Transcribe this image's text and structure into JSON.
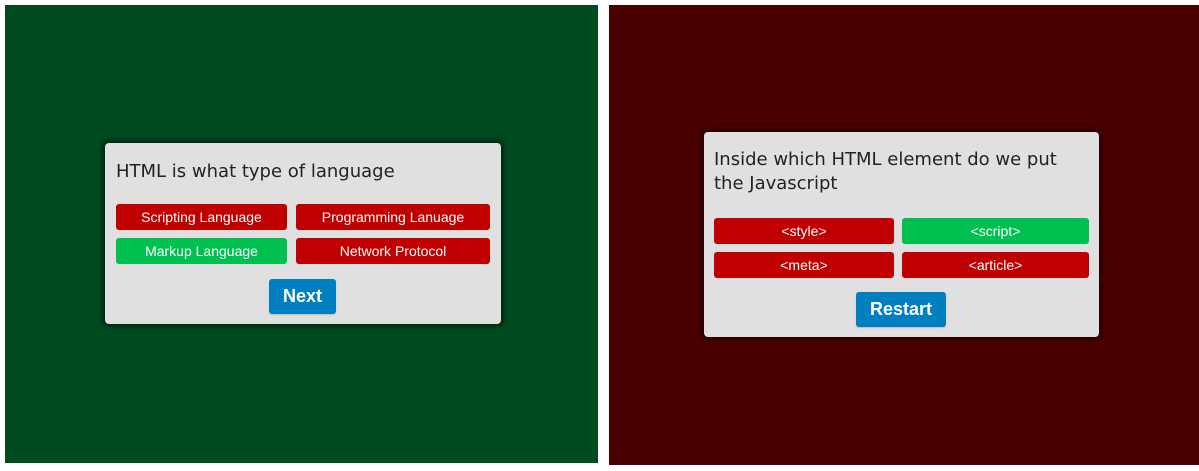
{
  "left_screen": {
    "background": "#004b20",
    "question": "HTML is what type of language",
    "answers": [
      {
        "label": "Scripting Language",
        "state": "wrong",
        "color": "#c00000"
      },
      {
        "label": "Programming Lanuage",
        "state": "wrong",
        "color": "#c00000"
      },
      {
        "label": "Markup Language",
        "state": "correct",
        "color": "#00c050"
      },
      {
        "label": "Network Protocol",
        "state": "wrong",
        "color": "#c00000"
      }
    ],
    "button_label": "Next"
  },
  "right_screen": {
    "background": "#4b0000",
    "question": "Inside which HTML element do we put the Javascript",
    "answers": [
      {
        "label": "<style>",
        "state": "wrong",
        "color": "#c00000"
      },
      {
        "label": "<script>",
        "state": "correct",
        "color": "#00c050"
      },
      {
        "label": "<meta>",
        "state": "wrong",
        "color": "#c00000"
      },
      {
        "label": "<article>",
        "state": "wrong",
        "color": "#c00000"
      }
    ],
    "button_label": "Restart"
  },
  "colors": {
    "button_blue": "#0080c0",
    "card_bg": "#e0e0e0"
  }
}
